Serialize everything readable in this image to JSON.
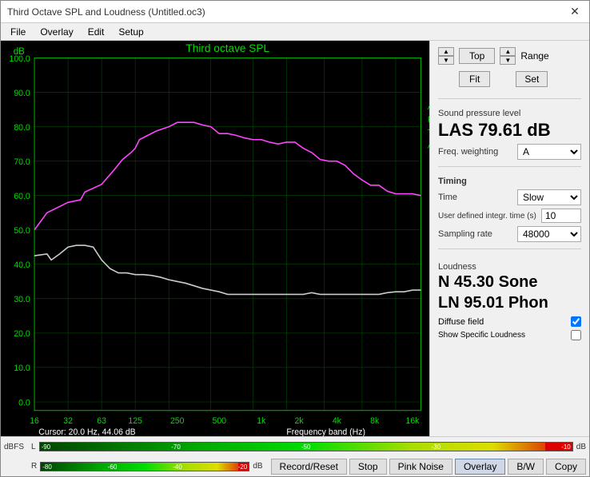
{
  "window": {
    "title": "Third Octave SPL and Loudness (Untitled.oc3)",
    "close_label": "✕"
  },
  "menu": {
    "items": [
      "File",
      "Overlay",
      "Edit",
      "Setup"
    ]
  },
  "chart": {
    "title": "Third octave SPL",
    "db_label": "dB",
    "arta_label": "ARTA",
    "y_axis": [
      "100.0",
      "90.0",
      "80.0",
      "70.0",
      "60.0",
      "50.0",
      "40.0",
      "30.0",
      "20.0",
      "10.0",
      "0.0"
    ],
    "x_axis": [
      "16",
      "32",
      "63",
      "125",
      "250",
      "500",
      "1k",
      "2k",
      "4k",
      "8k",
      "16k"
    ],
    "cursor_info": "Cursor:  20.0 Hz, 44.06 dB",
    "freq_band_label": "Frequency band (Hz)"
  },
  "controls": {
    "top_label": "Top",
    "fit_label": "Fit",
    "range_label": "Range",
    "set_label": "Set"
  },
  "spl": {
    "section_label": "Sound pressure level",
    "value": "LAS 79.61 dB",
    "freq_weighting_label": "Freq. weighting",
    "freq_weighting_value": "A"
  },
  "timing": {
    "section_label": "Timing",
    "time_label": "Time",
    "time_value": "Slow",
    "user_defined_label": "User defined integr. time (s)",
    "user_defined_value": "10",
    "sampling_rate_label": "Sampling rate",
    "sampling_rate_value": "48000"
  },
  "loudness": {
    "section_label": "Loudness",
    "n_value": "N 45.30 Sone",
    "ln_value": "LN 95.01 Phon",
    "diffuse_field_label": "Diffuse field",
    "diffuse_field_checked": true,
    "show_specific_label": "Show Specific Loudness",
    "show_specific_checked": false
  },
  "meter": {
    "left_label": "dBFS",
    "left_channel": "L",
    "right_channel": "R",
    "ticks_top": [
      "-90",
      "-70",
      "-50",
      "-30",
      "-10"
    ],
    "ticks_bottom": [
      "-80",
      "-60",
      "-40",
      "-20"
    ],
    "db_label": "dB"
  },
  "buttons": {
    "record_reset": "Record/Reset",
    "stop": "Stop",
    "pink_noise": "Pink Noise",
    "overlay": "Overlay",
    "bw": "B/W",
    "copy": "Copy"
  }
}
